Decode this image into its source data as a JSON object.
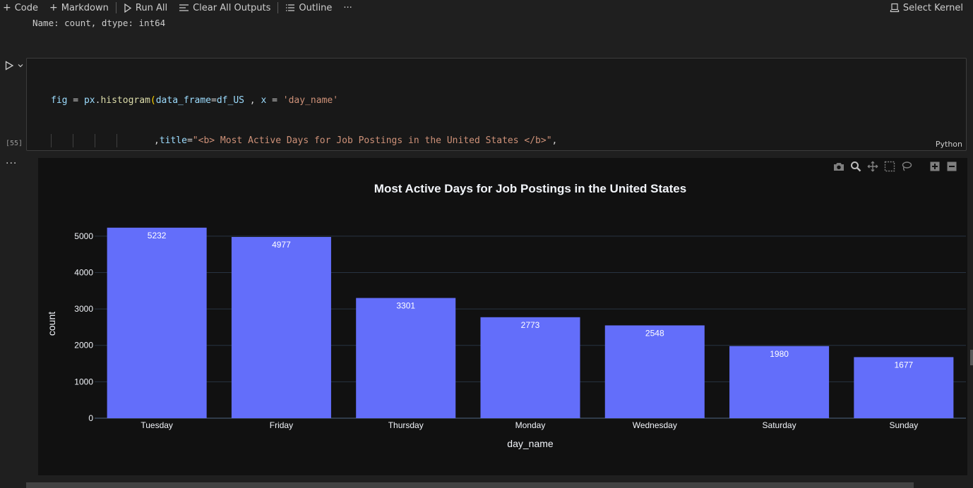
{
  "toolbar": {
    "code_label": "Code",
    "markdown_label": "Markdown",
    "run_all_label": "Run All",
    "clear_outputs_label": "Clear All Outputs",
    "outline_label": "Outline",
    "more_label": "···",
    "select_kernel_label": "Select Kernel"
  },
  "previous_output": "Name: count, dtype: int64",
  "cell": {
    "execution_count": "[55]",
    "language": "Python",
    "more_label": "···"
  },
  "plot": {
    "modebar_icons": [
      "camera-icon",
      "zoom-icon",
      "pan-icon",
      "select-box-icon",
      "lasso-icon",
      "zoom-in-icon",
      "zoom-out-icon"
    ]
  },
  "colors": {
    "bar": "#636efa",
    "plot_bg": "#111111",
    "grid": "#283442"
  },
  "chart_data": {
    "type": "bar",
    "title": "Most Active Days for Job Postings in the United States",
    "xlabel": "day_name",
    "ylabel": "count",
    "categories": [
      "Tuesday",
      "Friday",
      "Thursday",
      "Monday",
      "Wednesday",
      "Saturday",
      "Sunday"
    ],
    "values": [
      5232,
      4977,
      3301,
      2773,
      2548,
      1980,
      1677
    ],
    "ylim": [
      0,
      5500
    ],
    "yticks": [
      0,
      1000,
      2000,
      3000,
      4000,
      5000
    ],
    "grid": true,
    "data_labels": true
  }
}
